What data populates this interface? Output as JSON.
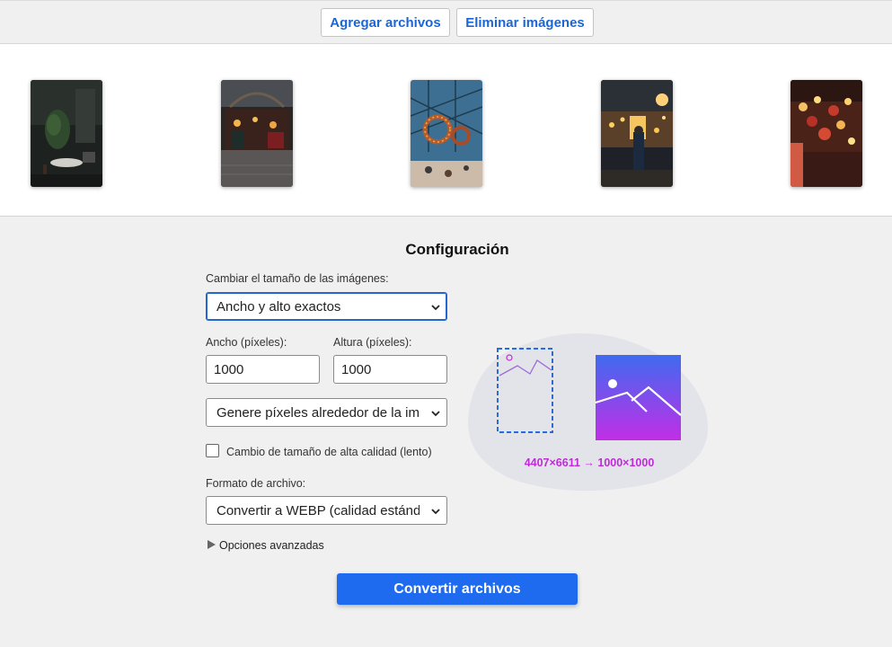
{
  "toolbar": {
    "add_label": "Agregar archivos",
    "remove_label": "Eliminar imágenes"
  },
  "gallery": {
    "thumbnails": [
      {
        "name": "thumbnail-1"
      },
      {
        "name": "thumbnail-2"
      },
      {
        "name": "thumbnail-3"
      },
      {
        "name": "thumbnail-4"
      },
      {
        "name": "thumbnail-5"
      }
    ]
  },
  "settings": {
    "title": "Configuración",
    "resize_label": "Cambiar el tamaño de las imágenes:",
    "resize_value": "Ancho y alto exactos",
    "width_label": "Ancho (píxeles):",
    "width_value": "1000",
    "height_label": "Altura (píxeles):",
    "height_value": "1000",
    "fit_value": "Genere píxeles alrededor de la imagen",
    "hq_label": "Cambio de tamaño de alta calidad (lento)",
    "hq_checked": false,
    "format_label": "Formato de archivo:",
    "format_value": "Convertir a WEBP (calidad estándar)",
    "advanced_label": "Opciones avanzadas",
    "convert_label": "Convertir archivos"
  },
  "preview": {
    "dimensions": "4407×6611 → 1000×1000",
    "accent_color": "#c02ad8",
    "gradient_top": "#3f6bf0",
    "gradient_bottom": "#c12ee6"
  }
}
